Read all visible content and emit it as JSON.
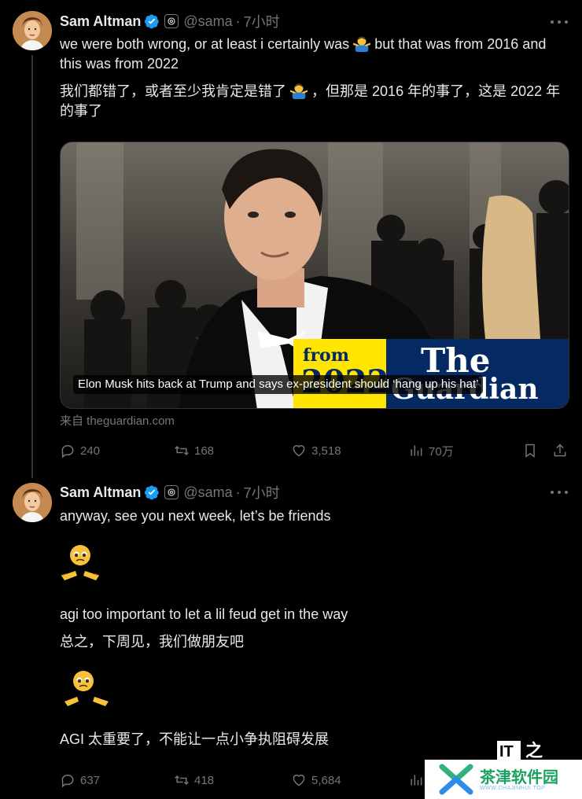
{
  "tweets": [
    {
      "author": {
        "name": "Sam Altman",
        "handle": "@sama",
        "time": "7小时",
        "avatar": "avatar-illustration",
        "verified_color": "#1d9bf0"
      },
      "text_en": "we were both wrong, or at least i certainly was",
      "text_en_2": "but that was from 2016 and this was from 2022",
      "text_zh": "我们都错了，或者至少我肯定是错了",
      "text_zh_2": "，但那是 2016 年的事了，这是 2022 年的事了",
      "card": {
        "image": "photo-elon-musk-tuxedo",
        "badge_from": "from",
        "badge_year": "2022",
        "brand": "The Guardian",
        "caption": "Elon Musk hits back at Trump and says ex-president should ‘hang up his hat’"
      },
      "source": "来自 theguardian.com",
      "stats": {
        "replies": "240",
        "reposts": "168",
        "likes": "3,518",
        "views": "70万"
      }
    },
    {
      "author": {
        "name": "Sam Altman",
        "handle": "@sama",
        "time": "7小时"
      },
      "line1": "anyway, see you next week, let’s be friends",
      "line2": "agi too important to let a lil feud get in the way",
      "line3": "总之，下周见，我们做朋友吧",
      "line4": "AGI 太重要了，不能让一点小争执阻碍发展",
      "stats": {
        "replies": "637",
        "reposts": "418",
        "likes": "5,684"
      }
    }
  ],
  "watermark": {
    "brand": "茶津软件园",
    "domain": "WWW.CHAJINHUI.TOP",
    "corner": "IT 之"
  },
  "colors": {
    "background": "#000000",
    "text": "#e7e9ea",
    "muted": "#71767b",
    "accent": "#1d9bf0"
  }
}
